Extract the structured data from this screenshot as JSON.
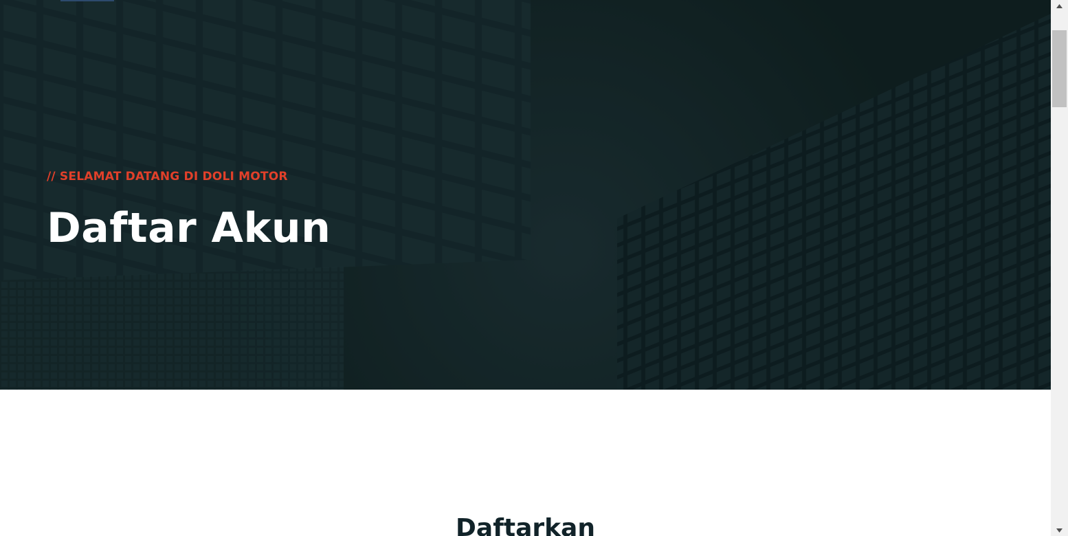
{
  "hero": {
    "subtitle": "// SELAMAT DATANG DI DOLI MOTOR",
    "title": "Daftar Akun"
  },
  "main": {
    "section_title": "Daftarkan"
  },
  "icons": {
    "scroll_up": "triangle-up-icon",
    "scroll_down": "triangle-down-icon"
  },
  "colors": {
    "accent": "#e2402a",
    "hero_overlay": "#14262a",
    "heading_dark": "#112329"
  }
}
